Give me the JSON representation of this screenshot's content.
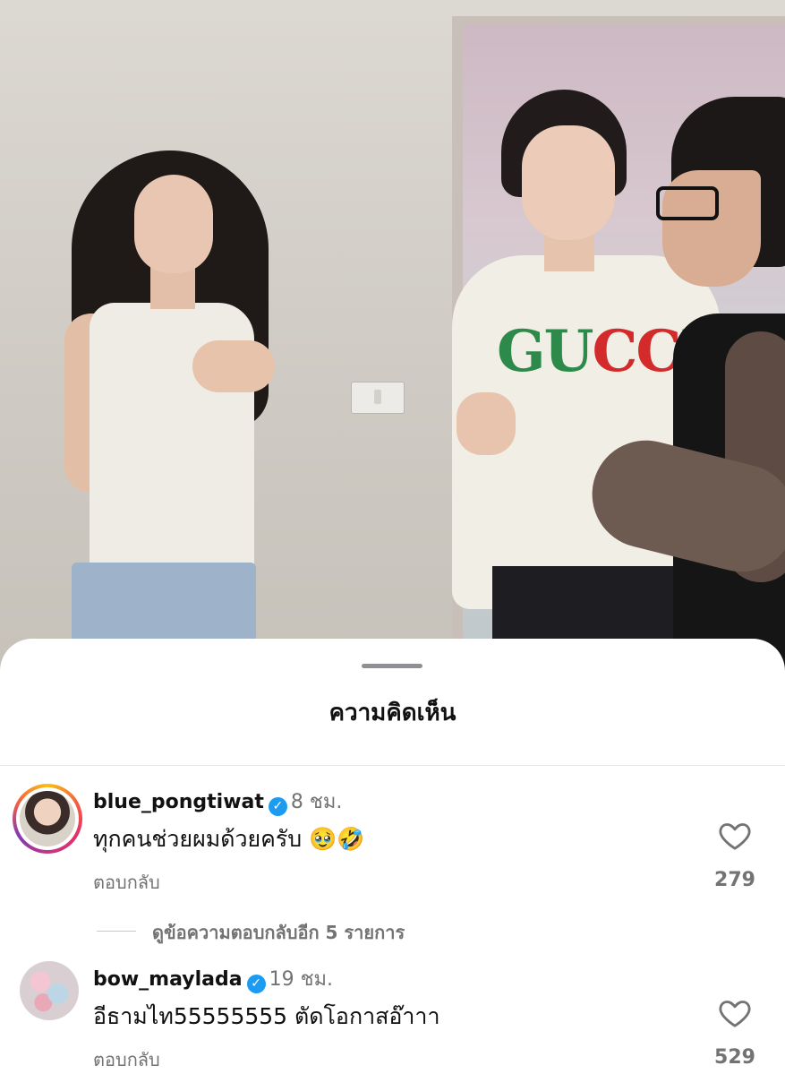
{
  "sheet": {
    "title": "ความคิดเห็น"
  },
  "comments": [
    {
      "username": "blue_pongtiwat",
      "verified": true,
      "time": "8 ชม.",
      "text": "ทุกคนช่วยผมด้วยครับ 🥹🤣",
      "reply_label": "ตอบกลับ",
      "likes": "279",
      "avatar_story_ring": true
    },
    {
      "username": "bow_maylada",
      "verified": true,
      "time": "19 ชม.",
      "text": "อีธามไท55555555 ตัดโอกาสอ๊าาา",
      "reply_label": "ตอบกลับ",
      "likes": "529",
      "avatar_story_ring": false
    }
  ],
  "replies_link": "ดูข้อความตอบกลับอีก 5 รายการ",
  "video": {
    "shirt_text": "GUCCI"
  },
  "colors": {
    "verified": "#1d9bf0",
    "secondary_text": "#737373",
    "primary_text": "#111111"
  },
  "icons": {
    "like": "heart-outline-icon",
    "verified": "verified-badge-icon"
  }
}
